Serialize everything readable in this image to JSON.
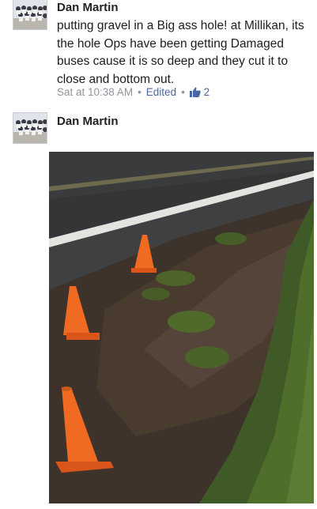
{
  "post1": {
    "author": "Dan Martin",
    "text": "putting gravel in a Big ass hole! at Millikan, its the hole Ops have been getting Damaged buses cause it is so deep and they cut it to close and bottom out.",
    "timestamp": "Sat at 10:38 AM",
    "edited_label": "Edited",
    "like_count": "2"
  },
  "post2": {
    "author": "Dan Martin"
  },
  "icons": {
    "like": "thumbs-up-icon",
    "separator": "dot"
  },
  "colors": {
    "link": "#4b67a1",
    "meta": "#90949c",
    "cone": "#f06a22"
  }
}
